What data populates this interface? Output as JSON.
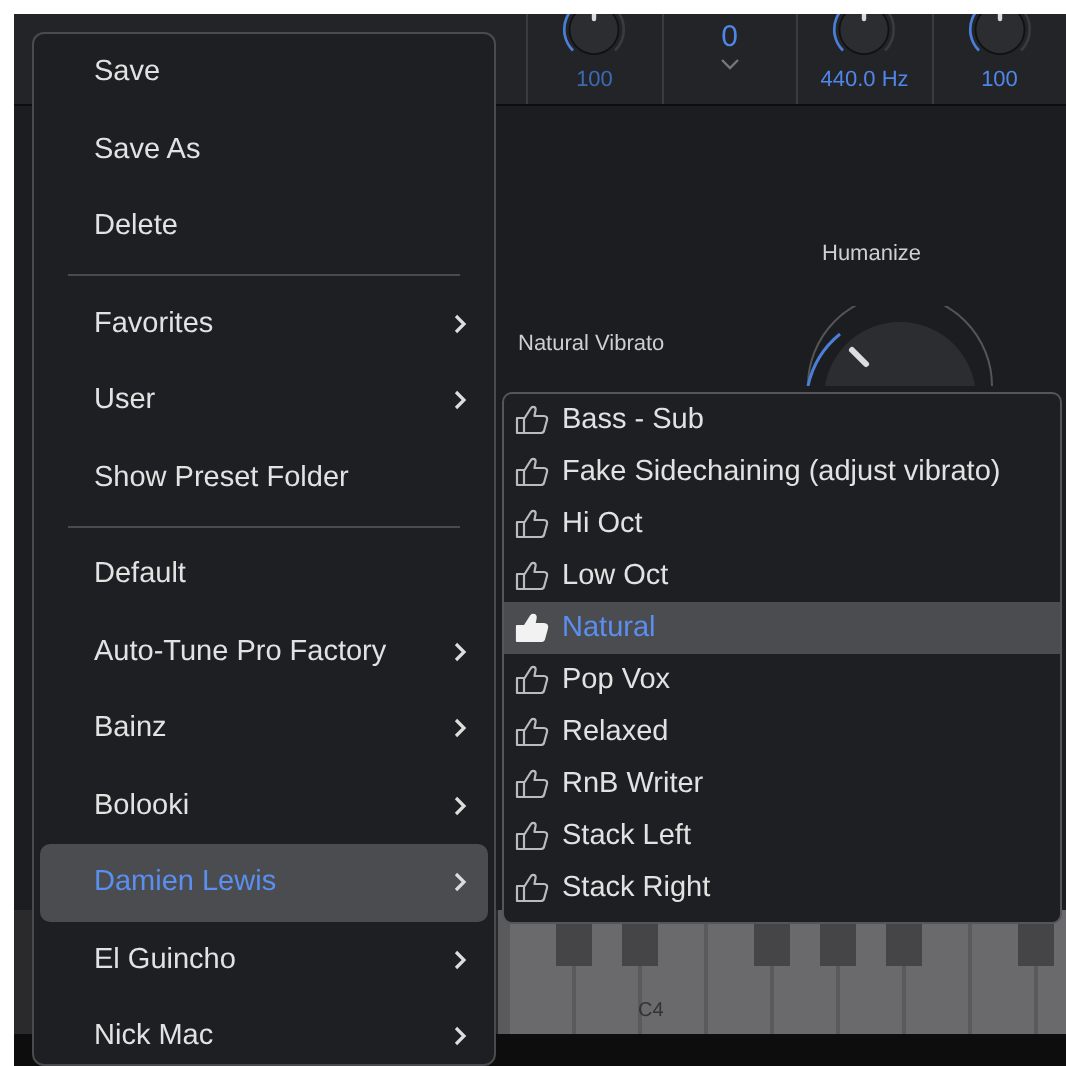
{
  "top_bar": {
    "controls": [
      {
        "kind": "knob",
        "value": "100"
      },
      {
        "kind": "stepper",
        "value": "0"
      },
      {
        "kind": "knob",
        "value": "440.0 Hz"
      },
      {
        "kind": "knob",
        "value": "100"
      }
    ]
  },
  "knob_labels": [
    "Humanize",
    "Natural Vibrato"
  ],
  "keyboard": {
    "label": "C4"
  },
  "preset_menu": {
    "items": [
      {
        "kind": "item",
        "label": "Save",
        "selected": false
      },
      {
        "kind": "item",
        "label": "Save As",
        "selected": false
      },
      {
        "kind": "item",
        "label": "Delete",
        "selected": false
      },
      {
        "kind": "separator"
      },
      {
        "kind": "submenu",
        "label": "Favorites",
        "selected": false
      },
      {
        "kind": "submenu",
        "label": "User",
        "selected": false
      },
      {
        "kind": "item",
        "label": "Show Preset Folder",
        "selected": false
      },
      {
        "kind": "separator"
      },
      {
        "kind": "item",
        "label": "Default",
        "selected": false
      },
      {
        "kind": "submenu",
        "label": "Auto-Tune Pro Factory",
        "selected": false
      },
      {
        "kind": "submenu",
        "label": "Bainz",
        "selected": false
      },
      {
        "kind": "submenu",
        "label": "Bolooki",
        "selected": false
      },
      {
        "kind": "submenu",
        "label": "Damien Lewis",
        "selected": true
      },
      {
        "kind": "submenu",
        "label": "El Guincho",
        "selected": false
      },
      {
        "kind": "submenu",
        "label": "Nick Mac",
        "selected": false
      }
    ]
  },
  "preset_submenu": {
    "items": [
      {
        "label": "Bass - Sub",
        "selected": false
      },
      {
        "label": "Fake Sidechaining (adjust vibrato)",
        "selected": false
      },
      {
        "label": "Hi Oct",
        "selected": false
      },
      {
        "label": "Low Oct",
        "selected": false
      },
      {
        "label": "Natural",
        "selected": true
      },
      {
        "label": "Pop Vox",
        "selected": false
      },
      {
        "label": "Relaxed",
        "selected": false
      },
      {
        "label": "RnB Writer",
        "selected": false
      },
      {
        "label": "Stack Left",
        "selected": false
      },
      {
        "label": "Stack Right",
        "selected": false
      }
    ]
  }
}
